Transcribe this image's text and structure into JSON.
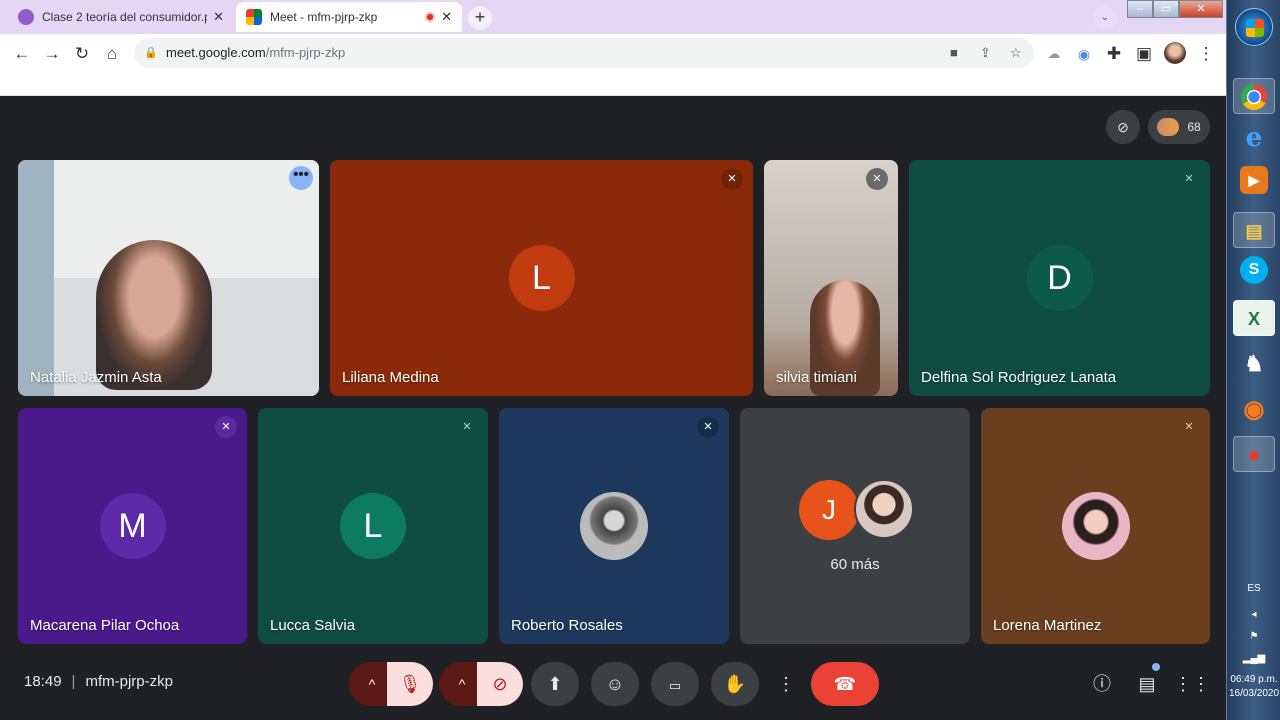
{
  "browser": {
    "tabs": [
      {
        "title": "Clase 2 teoría del consumidor.pdf",
        "close": "✕"
      },
      {
        "title": "Meet - mfm-pjrp-zkp",
        "close": "✕"
      }
    ],
    "new_tab": "+",
    "tab_search": "⌄",
    "url_host": "meet.google.com",
    "url_path": "/mfm-pjrp-zkp",
    "window_buttons": {
      "min": "–",
      "max": "▭",
      "close": "✕"
    }
  },
  "meet": {
    "participant_count": "68",
    "tiles": [
      {
        "name": "Natalia Jazmin Asta"
      },
      {
        "name": "Liliana Medina",
        "initial": "L"
      },
      {
        "name": "silvia timiani"
      },
      {
        "name": "Delfina Sol Rodriguez Lanata",
        "initial": "D"
      },
      {
        "name": "Macarena Pilar Ochoa",
        "initial": "M"
      },
      {
        "name": "Lucca Salvia",
        "initial": "L"
      },
      {
        "name": "Roberto Rosales"
      },
      {
        "more_label": "60 más",
        "initial": "J"
      },
      {
        "name": "Lorena Martinez"
      }
    ],
    "time": "18:49",
    "meeting_code": "mfm-pjrp-zkp",
    "more_menu": "⋮",
    "dots_menu": "•••"
  },
  "taskbar": {
    "apps": [
      {
        "icon": "chrome-icon"
      },
      {
        "icon": "internet-explorer-icon",
        "glyph": "e"
      },
      {
        "icon": "media-player-icon",
        "glyph": "▶"
      },
      {
        "icon": "file-explorer-icon",
        "glyph": "▤"
      },
      {
        "icon": "skype-icon",
        "glyph": "S"
      },
      {
        "icon": "excel-icon",
        "glyph": "X"
      },
      {
        "icon": "chess-icon",
        "glyph": "♞"
      },
      {
        "icon": "firefox-icon",
        "glyph": "◉"
      },
      {
        "icon": "recorder-icon",
        "glyph": "●"
      }
    ],
    "language": "ES",
    "clock_time": "06:49 p.m.",
    "clock_date": "16/03/2020"
  },
  "colors": {
    "meet_bg": "#202124",
    "end_call": "#ea4335",
    "selected_outline": "#8ab4f8"
  }
}
